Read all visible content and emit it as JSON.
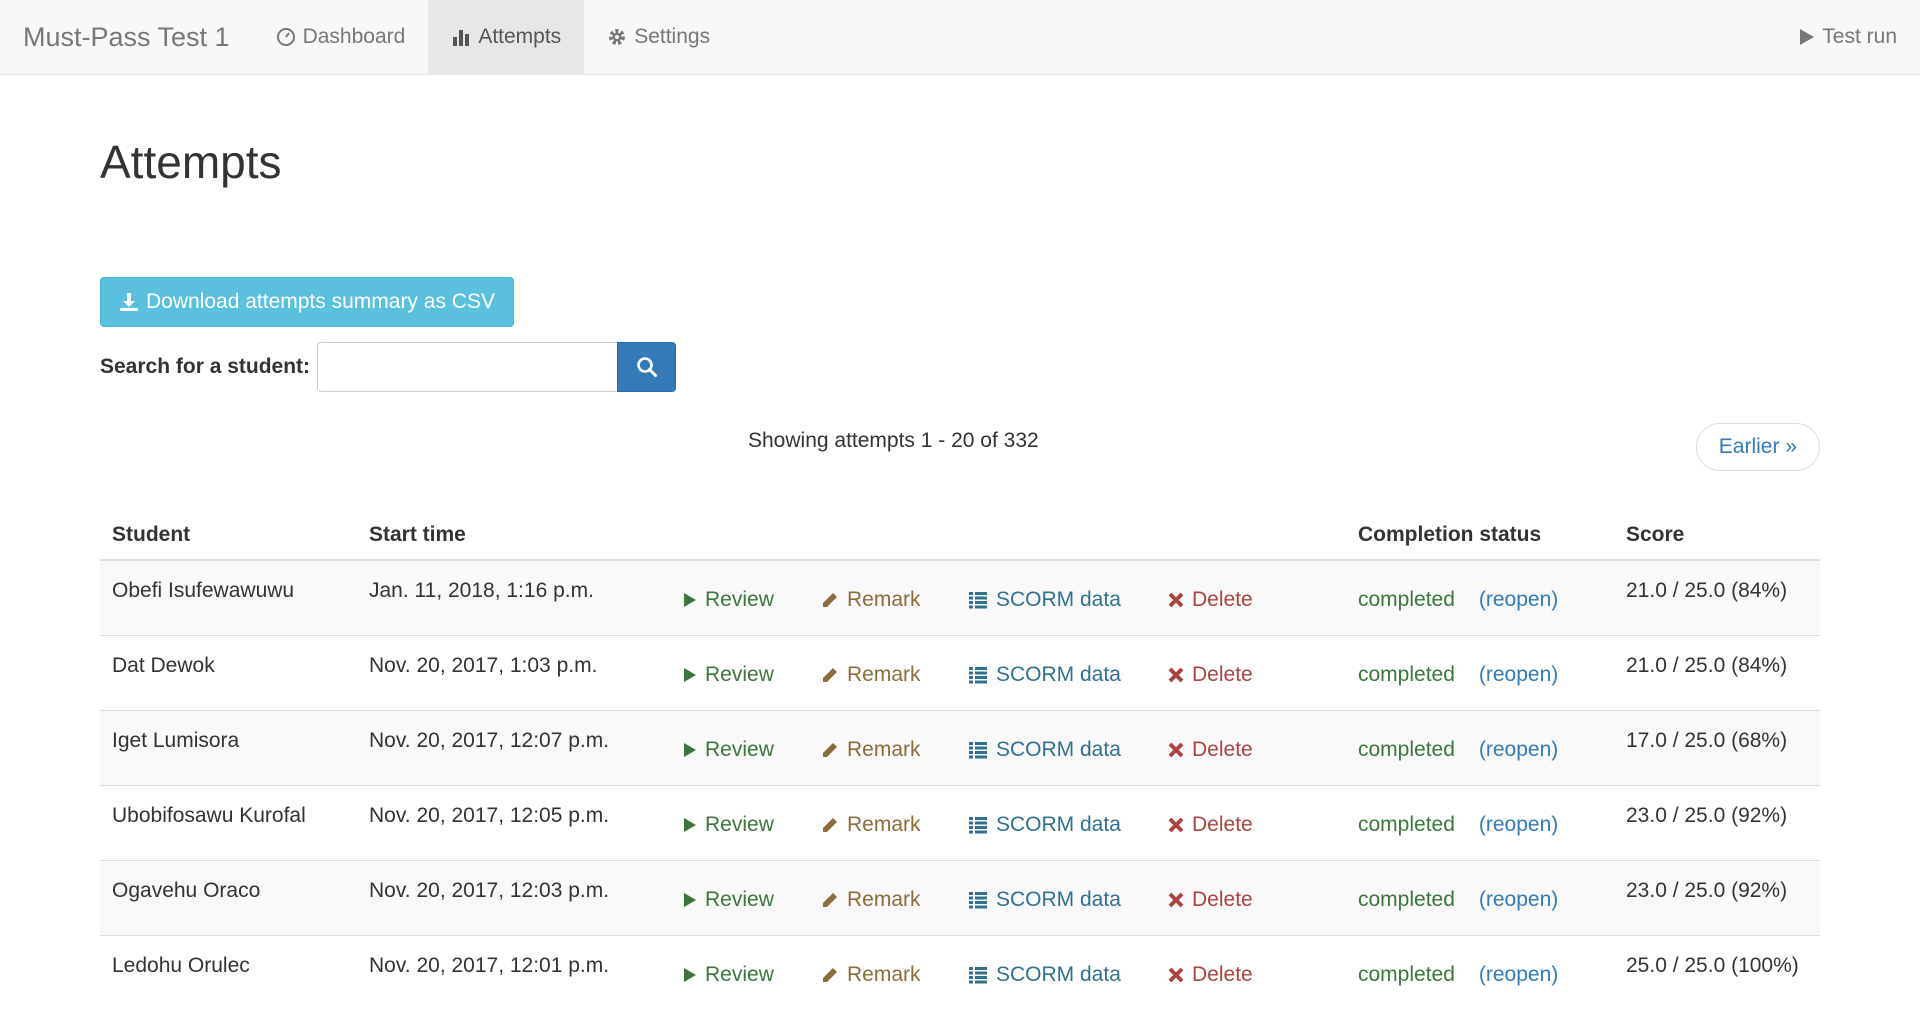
{
  "navbar": {
    "brand": "Must-Pass Test 1",
    "items": [
      {
        "label": "Dashboard"
      },
      {
        "label": "Attempts"
      },
      {
        "label": "Settings"
      }
    ],
    "test_run": "Test run"
  },
  "page": {
    "title": "Attempts",
    "csv_button": "Download attempts summary as CSV",
    "search_label": "Search for a student:",
    "search_value": "",
    "showing": "Showing attempts 1 - 20 of 332",
    "earlier": "Earlier »"
  },
  "table": {
    "headers": {
      "student": "Student",
      "start_time": "Start time",
      "completion": "Completion status",
      "score": "Score"
    },
    "actions": {
      "review": "Review",
      "remark": "Remark",
      "scorm": "SCORM data",
      "delete": "Delete",
      "reopen": "(reopen)"
    },
    "rows": [
      {
        "student": "Obefi Isufewawuwu",
        "start": "Jan. 11, 2018, 1:16 p.m.",
        "status": "completed",
        "score": "21.0 / 25.0 (84%)"
      },
      {
        "student": "Dat Dewok",
        "start": "Nov. 20, 2017, 1:03 p.m.",
        "status": "completed",
        "score": "21.0 / 25.0 (84%)"
      },
      {
        "student": "Iget Lumisora",
        "start": "Nov. 20, 2017, 12:07 p.m.",
        "status": "completed",
        "score": "17.0 / 25.0 (68%)"
      },
      {
        "student": "Ubobifosawu Kurofal",
        "start": "Nov. 20, 2017, 12:05 p.m.",
        "status": "completed",
        "score": "23.0 / 25.0 (92%)"
      },
      {
        "student": "Ogavehu Oraco",
        "start": "Nov. 20, 2017, 12:03 p.m.",
        "status": "completed",
        "score": "23.0 / 25.0 (92%)"
      },
      {
        "student": "Ledohu Orulec",
        "start": "Nov. 20, 2017, 12:01 p.m.",
        "status": "completed",
        "score": "25.0 / 25.0 (100%)"
      }
    ]
  },
  "icons": {
    "dashboard": "dashboard-icon",
    "attempts": "bar-chart-icon",
    "settings": "gear-icon",
    "test_run": "play-icon",
    "csv": "download-icon",
    "search": "search-icon"
  },
  "colors": {
    "info": "#5bc0de",
    "primary": "#337ab7",
    "success": "#3c763d",
    "warning": "#8a6d3b",
    "scorm": "#31708f",
    "danger": "#a94442"
  }
}
